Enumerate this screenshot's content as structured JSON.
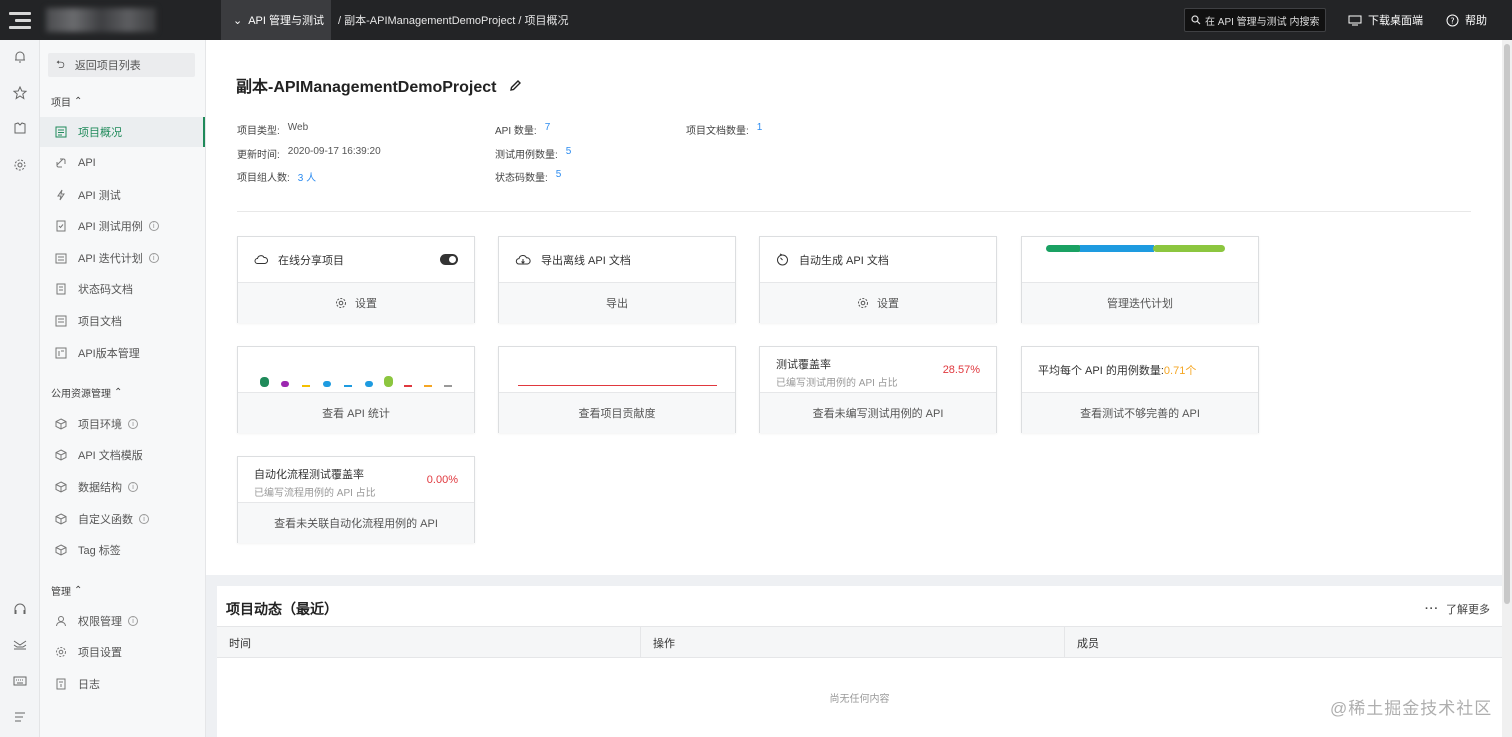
{
  "topbar": {
    "nav_current": "API 管理与测试",
    "breadcrumb": "/ 副本-APIManagementDemoProject / 项目概况",
    "search_placeholder": "在 API 管理与测试 内搜索",
    "download_label": "下载桌面端",
    "help_label": "帮助"
  },
  "sidebar": {
    "back_label": "返回项目列表",
    "groups": [
      {
        "title": "项目"
      },
      {
        "title": "公用资源管理"
      },
      {
        "title": "管理"
      }
    ],
    "items": [
      {
        "label": "项目概况",
        "icon": "overview-icon",
        "active": true
      },
      {
        "label": "API",
        "icon": "link-icon"
      },
      {
        "label": "API 测试",
        "icon": "bolt-icon"
      },
      {
        "label": "API 测试用例",
        "icon": "testcase-icon",
        "info": true
      },
      {
        "label": "API 迭代计划",
        "icon": "plan-icon",
        "info": true
      },
      {
        "label": "状态码文档",
        "icon": "doc-icon"
      },
      {
        "label": "项目文档",
        "icon": "doc-icon"
      },
      {
        "label": "API版本管理",
        "icon": "version-icon"
      },
      {
        "label": "项目环境",
        "icon": "cube-icon",
        "info": true
      },
      {
        "label": "API 文档模版",
        "icon": "cube-icon"
      },
      {
        "label": "数据结构",
        "icon": "cube-icon",
        "info": true
      },
      {
        "label": "自定义函数",
        "icon": "cube-icon",
        "info": true
      },
      {
        "label": "Tag 标签",
        "icon": "cube-icon"
      },
      {
        "label": "权限管理",
        "icon": "user-icon",
        "info": true
      },
      {
        "label": "项目设置",
        "icon": "gear-icon"
      },
      {
        "label": "日志",
        "icon": "log-icon"
      }
    ]
  },
  "project": {
    "title": "副本-APIManagementDemoProject",
    "meta": [
      {
        "label": "项目类型:",
        "value": "Web",
        "blue": false
      },
      {
        "label": "更新时间:",
        "value": "2020-09-17 16:39:20",
        "blue": false
      },
      {
        "label": "项目组人数:",
        "value": "3 人",
        "blue": true
      },
      {
        "label": "API 数量:",
        "value": "7",
        "blue": true
      },
      {
        "label": "测试用例数量:",
        "value": "5",
        "blue": true
      },
      {
        "label": "状态码数量:",
        "value": "5",
        "blue": true
      },
      {
        "label": "项目文档数量:",
        "value": "1",
        "blue": true
      }
    ]
  },
  "cards": {
    "share": {
      "title": "在线分享项目",
      "action": "设置"
    },
    "export": {
      "title": "导出离线 API 文档",
      "action": "导出"
    },
    "autogen": {
      "title": "自动生成 API 文档",
      "action": "设置"
    },
    "iteration": {
      "action": "管理迭代计划"
    },
    "api_stats": {
      "action": "查看 API 统计"
    },
    "contribution": {
      "action": "查看项目贡献度"
    },
    "coverage": {
      "title": "测试覆盖率",
      "subtitle": "已编写测试用例的 API 占比",
      "value": "28.57%",
      "action": "查看未编写测试用例的 API"
    },
    "avg_cases": {
      "title": "平均每个 API 的用例数量:",
      "value": "0.71个",
      "action": "查看测试不够完善的 API"
    },
    "auto_coverage": {
      "title": "自动化流程测试覆盖率",
      "subtitle": "已编写流程用例的 API 占比",
      "value": "0.00%",
      "action": "查看未关联自动化流程用例的 API"
    }
  },
  "colors": {
    "accent": "#1f8a5a",
    "link": "#2d8cf0",
    "danger": "#e0383e",
    "warning": "#f5a623",
    "progress": [
      "#1aa163",
      "#1e9be0",
      "#8cc63f"
    ],
    "api_bars": [
      "#1f8a5a",
      "#9c27b0",
      "#f5c000",
      "#1e9be0",
      "#1e9be0",
      "#1e9be0",
      "#8cc63f",
      "#e0383e",
      "#f5a623",
      "#999999"
    ]
  },
  "activity": {
    "title": "项目动态（最近）",
    "more_label": "了解更多",
    "columns": [
      "时间",
      "操作",
      "成员"
    ],
    "empty_text": "尚无任何内容"
  },
  "watermark": "@稀土掘金技术社区"
}
